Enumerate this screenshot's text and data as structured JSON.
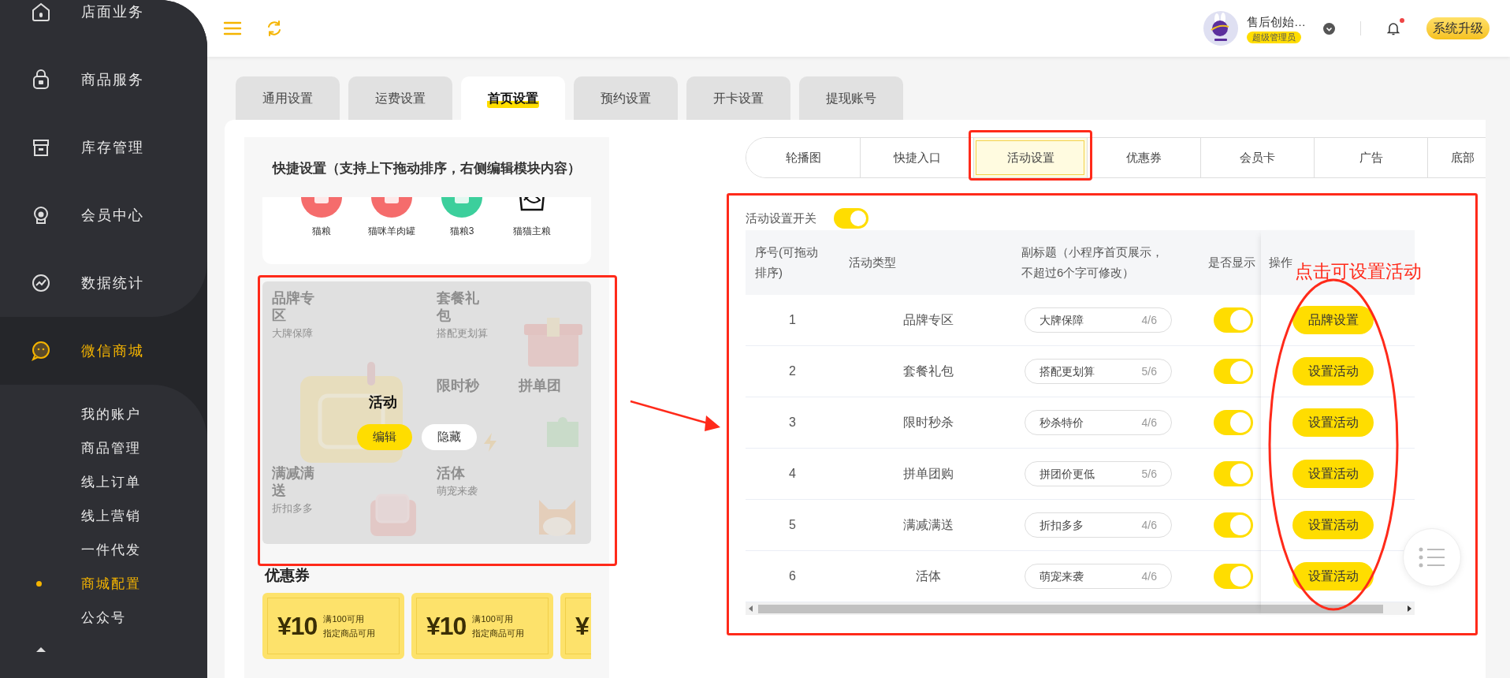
{
  "sidebar": {
    "items": [
      {
        "label": "店面业务",
        "selected": false
      },
      {
        "label": "商品服务",
        "selected": false
      },
      {
        "label": "库存管理",
        "selected": false
      },
      {
        "label": "会员中心",
        "selected": false
      },
      {
        "label": "数据统计",
        "selected": false
      },
      {
        "label": "微信商城",
        "selected": true
      }
    ],
    "subitems": [
      {
        "label": "我的账户",
        "selected": false
      },
      {
        "label": "商品管理",
        "selected": false
      },
      {
        "label": "线上订单",
        "selected": false
      },
      {
        "label": "线上营销",
        "selected": false
      },
      {
        "label": "一件代发",
        "selected": false
      },
      {
        "label": "商城配置",
        "selected": true
      },
      {
        "label": "公众号",
        "selected": false
      }
    ]
  },
  "header": {
    "user_name": "售后创始…",
    "role": "超级管理员",
    "has_notification": true,
    "upgrade_button": "系统升级"
  },
  "tabs": [
    {
      "label": "通用设置",
      "selected": false
    },
    {
      "label": "运费设置",
      "selected": false
    },
    {
      "label": "首页设置",
      "selected": true
    },
    {
      "label": "预约设置",
      "selected": false
    },
    {
      "label": "开卡设置",
      "selected": false
    },
    {
      "label": "提现账号",
      "selected": false
    }
  ],
  "preview": {
    "title": "快捷设置（支持上下拖动排序，右侧编辑模块内容）",
    "quick_entries": [
      {
        "label": "猫粮",
        "kind": "circle",
        "color": "#f56c6c"
      },
      {
        "label": "猫咪羊肉罐",
        "kind": "circle",
        "color": "#f56c6c"
      },
      {
        "label": "猫粮3",
        "kind": "circle",
        "color": "#3ccf9c"
      },
      {
        "label": "猫猫主粮",
        "kind": "outline"
      }
    ],
    "activity_block": {
      "title": "活动",
      "buttons": [
        {
          "label": "编辑",
          "kind": "primary"
        },
        {
          "label": "隐藏",
          "kind": "secondary"
        }
      ],
      "tiles": [
        {
          "title": "品牌专区",
          "subtitle": "大牌保障"
        },
        {
          "title": "套餐礼包",
          "subtitle": "搭配更划算"
        },
        {
          "title": "限时秒"
        },
        {
          "title": "拼单团"
        },
        {
          "title": "满减满送",
          "subtitle": "折扣多多"
        },
        {
          "title": "活体",
          "subtitle": "萌宠来袭"
        }
      ]
    },
    "coupons_title": "优惠券",
    "coupons": [
      {
        "amount": "¥10",
        "condition": "满100可用",
        "scope": "指定商品可用"
      },
      {
        "amount": "¥10",
        "condition": "满100可用",
        "scope": "指定商品可用"
      },
      {
        "amount": "¥"
      }
    ]
  },
  "sub_tabs": [
    {
      "label": "轮播图",
      "selected": false
    },
    {
      "label": "快捷入口",
      "selected": false
    },
    {
      "label": "活动设置",
      "selected": true
    },
    {
      "label": "优惠券",
      "selected": false
    },
    {
      "label": "会员卡",
      "selected": false
    },
    {
      "label": "广告",
      "selected": false
    },
    {
      "label": "底部",
      "selected": false
    }
  ],
  "activity_settings": {
    "switch_label": "活动设置开关",
    "switch_on": true,
    "columns": [
      "序号(可拖动排序)",
      "活动类型",
      "副标题（小程序首页展示，不超过6个字可修改）",
      "是否显示",
      "操作"
    ],
    "rows": [
      {
        "index": "1",
        "type": "品牌专区",
        "subtitle": "大牌保障",
        "count": "4/6",
        "shown": true,
        "action": "品牌设置"
      },
      {
        "index": "2",
        "type": "套餐礼包",
        "subtitle": "搭配更划算",
        "count": "5/6",
        "shown": true,
        "action": "设置活动"
      },
      {
        "index": "3",
        "type": "限时秒杀",
        "subtitle": "秒杀特价",
        "count": "4/6",
        "shown": true,
        "action": "设置活动"
      },
      {
        "index": "4",
        "type": "拼单团购",
        "subtitle": "拼团价更低",
        "count": "5/6",
        "shown": true,
        "action": "设置活动"
      },
      {
        "index": "5",
        "type": "满减满送",
        "subtitle": "折扣多多",
        "count": "4/6",
        "shown": true,
        "action": "设置活动"
      },
      {
        "index": "6",
        "type": "活体",
        "subtitle": "萌宠来袭",
        "count": "4/6",
        "shown": true,
        "action": "设置活动"
      }
    ]
  },
  "annotations": {
    "callout": "点击可设置活动"
  }
}
